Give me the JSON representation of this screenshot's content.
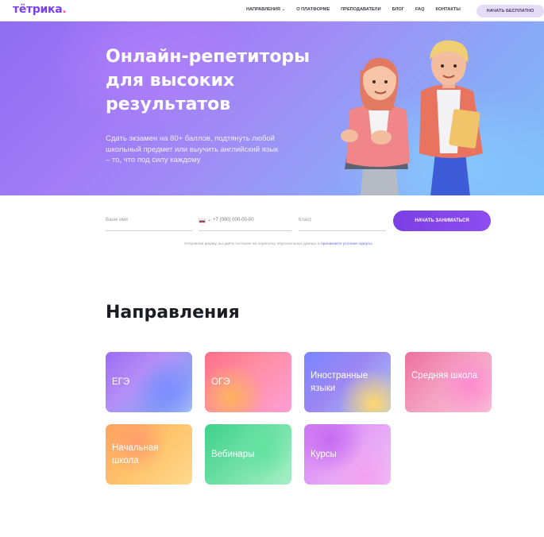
{
  "header": {
    "logo_text": "тётрика",
    "logo_dot": ".",
    "nav": [
      "Направления ⌄",
      "О платформе",
      "Преподаватели",
      "Блог",
      "FAQ",
      "Контакты"
    ],
    "cta_label": "Начать бесплатно"
  },
  "hero": {
    "title": "Онлайн-репетиторы для высоких результатов",
    "subtitle": "Сдать экзамен на 80+ баллов, подтянуть любой школьный предмет или выучить английский язык – то, что под силу каждому"
  },
  "form": {
    "name_placeholder": "Ваше имя",
    "phone_code_arrow": "⌄",
    "phone_placeholder": "+7 (000) 000-00-00",
    "class_placeholder": "Класс",
    "submit_label": "Начать заниматься",
    "policy_text": "Отправляя форму, вы даёте согласие на обработку персональных данных и ",
    "policy_link": "принимаете условия оферты"
  },
  "directions": {
    "title": "Направления",
    "cards": [
      "ЕГЭ",
      "ОГЭ",
      "Иностранные языки",
      "Средняя школа",
      "Начальная школа",
      "Вебинары",
      "Курсы"
    ]
  },
  "colors": {
    "brand_purple": "#7b3fe4",
    "logo_pink": "#ff4f9a",
    "hero_gradient_start": "#8f6df2",
    "hero_gradient_end": "#7ec0f8"
  }
}
